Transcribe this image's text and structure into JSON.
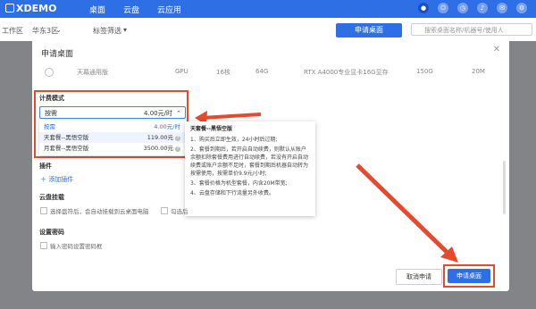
{
  "app": {
    "name": "XDEMO"
  },
  "nav": {
    "items": [
      "桌面",
      "云盘",
      "云应用"
    ]
  },
  "topbar": {
    "icons": [
      "user-icon",
      "power-icon",
      "clock-icon",
      "bell-icon",
      "message-icon",
      "settings-icon"
    ]
  },
  "filter": {
    "region_label": "工作区",
    "region_value": "华东3区",
    "tag_label": "标签筛选"
  },
  "header": {
    "apply_button": "申请桌面",
    "search_placeholder": "搜索桌面名称/机器号/使用人"
  },
  "modal": {
    "title": "申请桌面",
    "prev_row": {
      "name": "天幕通用版",
      "type": "GPU",
      "cores": "16核",
      "memory": "64G",
      "gpu": "RTX A4000专业显卡16G显存",
      "disk": "150G",
      "bandwidth": "20M"
    },
    "billing": {
      "label": "计费模式",
      "selected_name": "按需",
      "selected_price": "4.00元/时",
      "options": [
        {
          "name": "按需",
          "price": "4.00元/时"
        },
        {
          "name": "天套餐--黑悟空版",
          "price": "119.00元"
        },
        {
          "name": "月套餐--黑悟空版",
          "price": "3500.00元"
        }
      ]
    },
    "plugin": {
      "label": "插件",
      "add": "添加插件"
    },
    "cloud_mount": {
      "label": "云盘挂载",
      "option1": "选择盘符后，会自动挂载到云桌面电脑",
      "option2": "勾选后"
    },
    "password": {
      "label": "设置密码",
      "option": "输入密码设置密码框"
    },
    "tooltip": {
      "title": "天套餐--黑悟空版",
      "lines": [
        "1、购买后立即生效，24小时后过期;",
        "2、套餐到期后，若开启自动续费，则默认从账户余额扣除套餐费用进行自动续费，若没有开启自动续费或账户余额不足时，套餐到期后机器自动转为按需使用，按需单价9.9元/小时;",
        "3、套餐价格为机型套餐，内含20M带宽;",
        "4、云盘存储和下行流量另外收费。"
      ]
    },
    "cancel_button": "取消申请",
    "submit_button": "申请桌面"
  },
  "colors": {
    "accent": "#2f6fe5",
    "highlight_red": "#e64a2e"
  }
}
